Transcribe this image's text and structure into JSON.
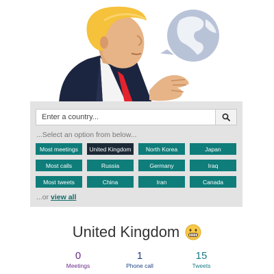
{
  "search": {
    "placeholder": "Enter a country...",
    "value": "",
    "icon": "search-icon"
  },
  "select_hint": "...Select an option from below...",
  "options": [
    {
      "label": "Most meetings",
      "selected": false
    },
    {
      "label": "United Kingdom",
      "selected": true
    },
    {
      "label": "North Korea",
      "selected": false
    },
    {
      "label": "Japan",
      "selected": false
    },
    {
      "label": "Most calls",
      "selected": false
    },
    {
      "label": "Russia",
      "selected": false
    },
    {
      "label": "Germany",
      "selected": false
    },
    {
      "label": "Iraq",
      "selected": false
    },
    {
      "label": "Most tweets",
      "selected": false
    },
    {
      "label": "China",
      "selected": false
    },
    {
      "label": "Iran",
      "selected": false
    },
    {
      "label": "Canada",
      "selected": false
    }
  ],
  "view_all": {
    "prefix": "...or ",
    "link": "view all"
  },
  "result": {
    "country": "United Kingdom",
    "emoji": "grimacing-face-icon",
    "stats": {
      "meetings": {
        "value": "0",
        "label": "Meetings"
      },
      "calls": {
        "value": "1",
        "label": "Phone call"
      },
      "tweets": {
        "value": "15",
        "label": "Tweets"
      }
    }
  },
  "colors": {
    "option_bg": "#0f7d7a",
    "option_selected_bg": "#1b2a36",
    "panel_bg": "#e3e3e3",
    "meetings": "#6b2a88",
    "calls": "#1e3f86",
    "tweets": "#177b85"
  }
}
